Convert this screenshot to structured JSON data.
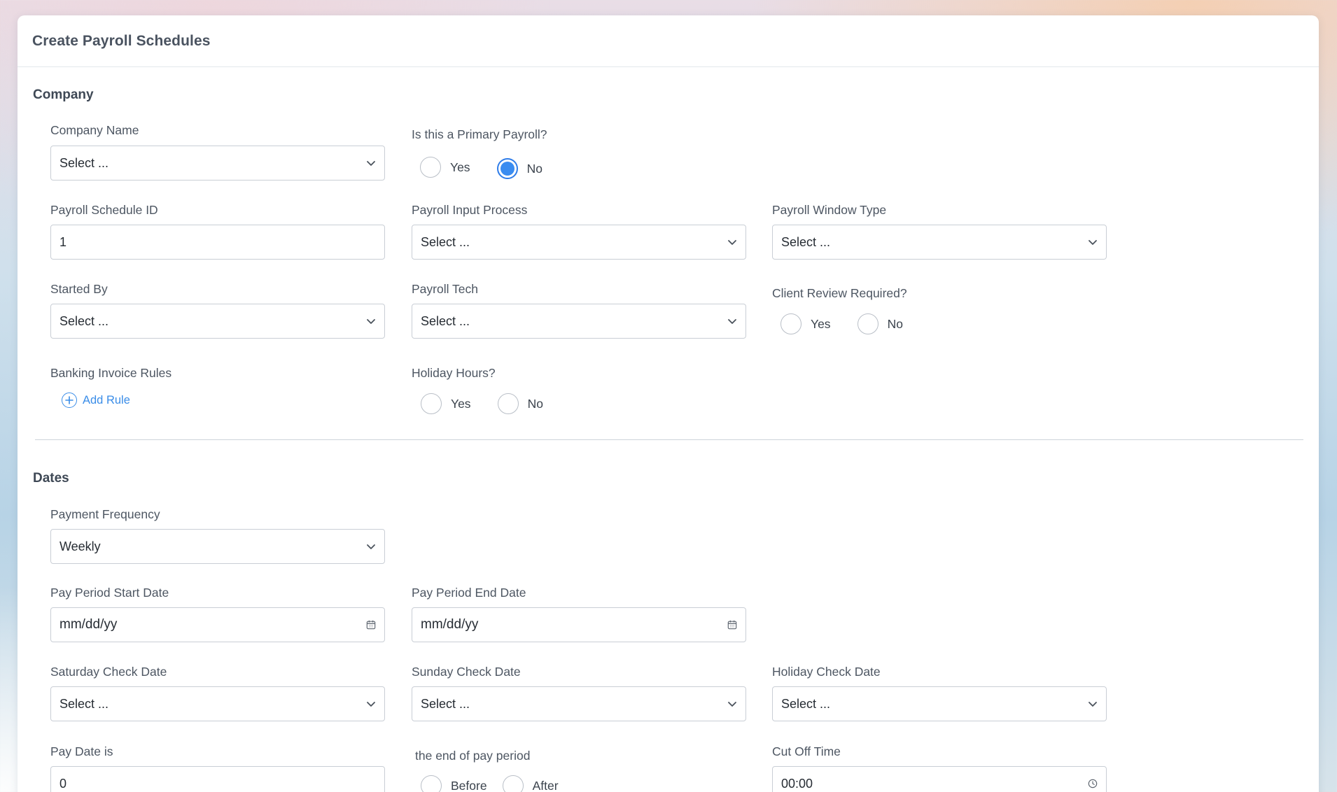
{
  "header": {
    "title": "Create Payroll Schedules"
  },
  "company": {
    "title": "Company",
    "company_name": {
      "label": "Company Name",
      "value": "Select ..."
    },
    "primary_payroll": {
      "label": "Is this a Primary Payroll?",
      "yes": "Yes",
      "no": "No",
      "selected": "No"
    },
    "schedule_id": {
      "label": "Payroll Schedule ID",
      "value": "1"
    },
    "input_process": {
      "label": "Payroll Input Process",
      "value": "Select ..."
    },
    "window_type": {
      "label": "Payroll Window Type",
      "value": "Select ..."
    },
    "started_by": {
      "label": "Started By",
      "value": "Select ..."
    },
    "payroll_tech": {
      "label": "Payroll Tech",
      "value": "Select ..."
    },
    "client_review": {
      "label": "Client Review Required?",
      "yes": "Yes",
      "no": "No"
    },
    "banking_rules": {
      "label": "Banking Invoice Rules",
      "add_label": "Add Rule"
    },
    "holiday_hours": {
      "label": "Holiday Hours?",
      "yes": "Yes",
      "no": "No"
    }
  },
  "dates": {
    "title": "Dates",
    "payment_frequency": {
      "label": "Payment Frequency",
      "value": "Weekly"
    },
    "start_date": {
      "label": "Pay Period Start Date",
      "placeholder": "mm/dd/yy"
    },
    "end_date": {
      "label": "Pay Period End Date",
      "placeholder": "mm/dd/yy"
    },
    "saturday_check": {
      "label": "Saturday Check Date",
      "value": "Select ..."
    },
    "sunday_check": {
      "label": "Sunday Check Date",
      "value": "Select ..."
    },
    "holiday_check": {
      "label": "Holiday Check Date",
      "value": "Select ..."
    },
    "pay_date": {
      "label": "Pay Date is",
      "value": "0"
    },
    "end_of_period": {
      "label": "the end of pay period",
      "before": "Before",
      "after": "After"
    },
    "cut_off": {
      "label": "Cut Off Time",
      "value": "00:00"
    }
  },
  "icons": {
    "chevron": "chevron-down-icon",
    "calendar": "calendar-icon",
    "clock": "clock-icon",
    "add": "plus-circle-icon"
  },
  "colors": {
    "accent": "#3a8cf0",
    "border": "#c9ced5",
    "text": "#3f4a57"
  }
}
